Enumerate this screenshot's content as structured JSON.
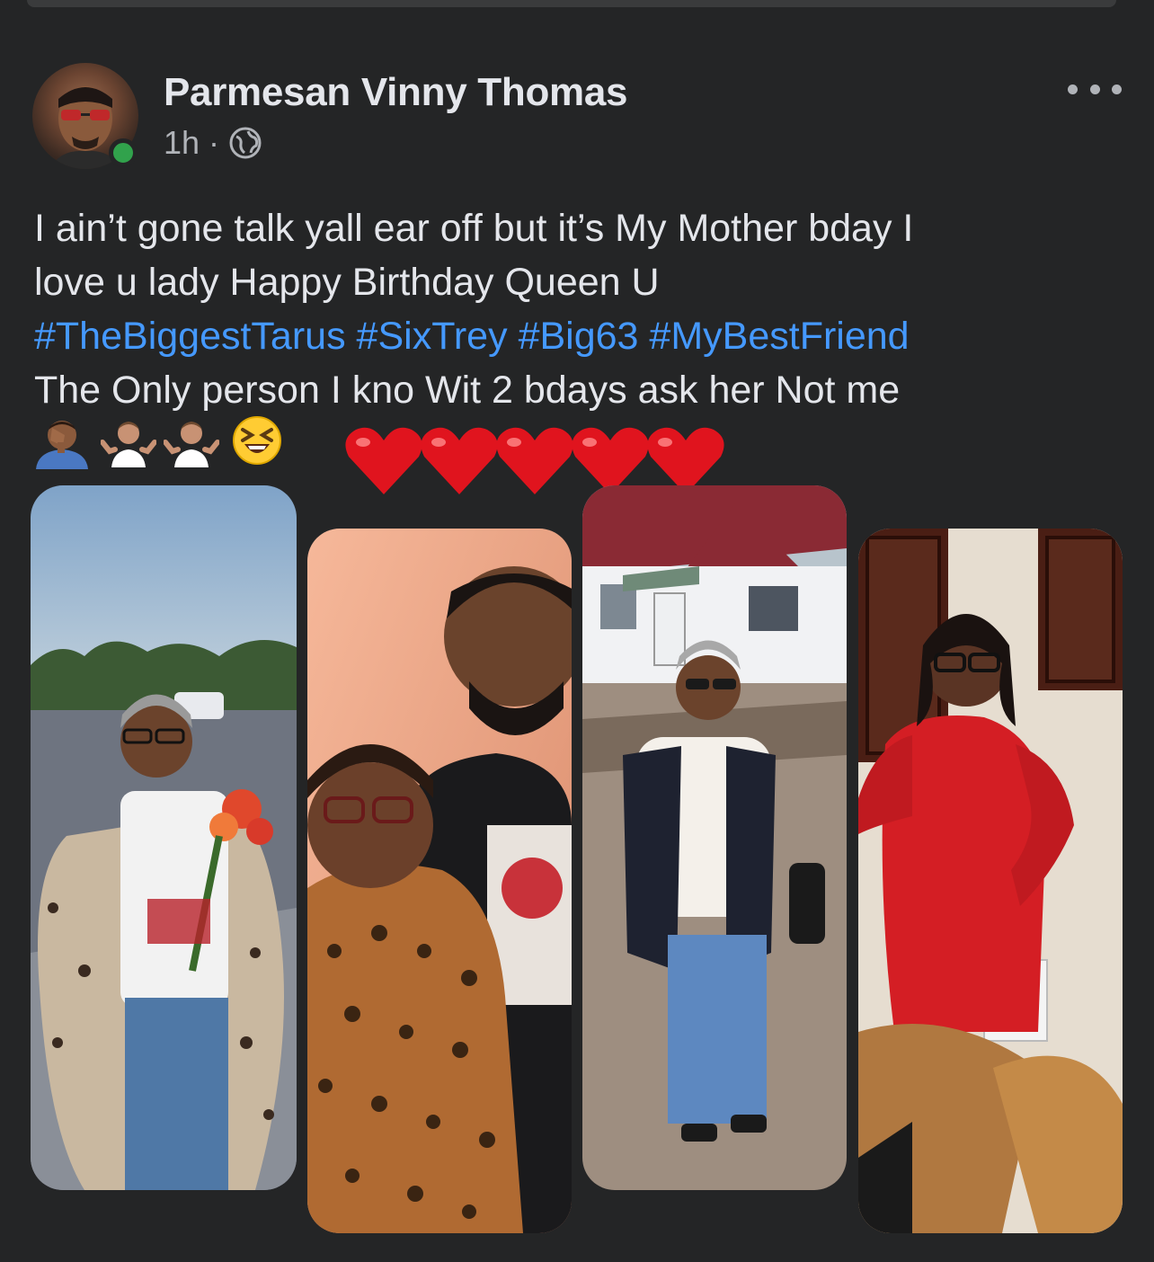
{
  "post": {
    "author": "Parmesan Vinny Thomas",
    "time": "1h",
    "separator": "·",
    "privacy_icon": "globe-icon",
    "more_icon": "more-horizontal-icon",
    "text_line1": "I ain’t gone talk yall ear off but it’s My Mother bday I",
    "text_line2": "love u lady Happy Birthday Queen U",
    "hashtags": [
      "#TheBiggestTarus",
      "#SixTrey",
      "#Big63",
      "#MyBestFriend"
    ],
    "text_line4": "The Only person I kno Wit 2 bdays ask her Not me",
    "emojis": [
      "face-palm-emoji",
      "shrug-emoji",
      "shrug-emoji",
      "laughing-squint-emoji",
      "red-heart-emoji",
      "red-heart-emoji",
      "red-heart-emoji",
      "red-heart-emoji",
      "red-heart-emoji"
    ]
  },
  "photos": [
    {
      "name": "photo-woman-with-flowers"
    },
    {
      "name": "photo-mother-and-son-selfie"
    },
    {
      "name": "photo-woman-in-front-of-house"
    },
    {
      "name": "photo-woman-in-red-dress"
    }
  ],
  "colors": {
    "background": "#242526",
    "text": "#e4e6eb",
    "secondary_text": "#b0b3b8",
    "hashtag": "#4599ff",
    "online": "#31a24c"
  }
}
